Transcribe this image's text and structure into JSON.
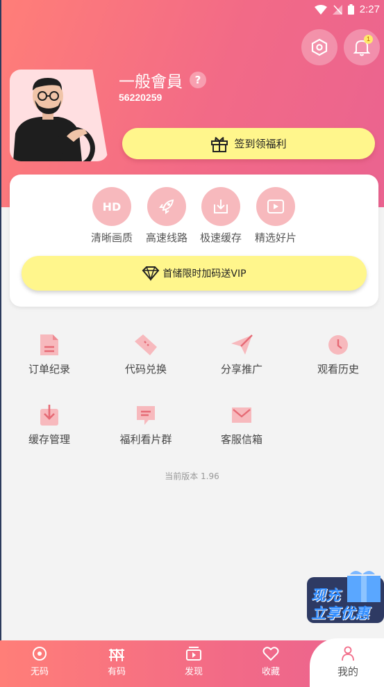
{
  "status_bar": {
    "time": "2:27"
  },
  "header": {
    "member_level": "一般會員",
    "help_label": "?",
    "user_id": "56220259",
    "notification_count": "1",
    "signin_label": "签到领福利"
  },
  "vip_card": {
    "features": [
      {
        "icon": "hd-icon",
        "icon_text": "HD",
        "label": "清晰画质"
      },
      {
        "icon": "rocket-icon",
        "label": "高速线路"
      },
      {
        "icon": "download-icon",
        "label": "极速缓存"
      },
      {
        "icon": "play-icon",
        "label": "精选好片"
      }
    ],
    "promo_label": "首储限时加码送VIP"
  },
  "tools": [
    {
      "icon": "document-icon",
      "label": "订单纪录"
    },
    {
      "icon": "ticket-icon",
      "label": "代码兑换"
    },
    {
      "icon": "paper-plane-icon",
      "label": "分享推广"
    },
    {
      "icon": "clock-icon",
      "label": "观看历史"
    },
    {
      "icon": "download-arrow-icon",
      "label": "缓存管理"
    },
    {
      "icon": "chat-icon",
      "label": "福利看片群"
    },
    {
      "icon": "mail-icon",
      "label": "客服信箱"
    }
  ],
  "version_text": "当前版本 1.96",
  "promo_badge": {
    "line1": "现充",
    "line2": "立享优惠"
  },
  "tabbar": [
    {
      "icon": "disc-icon",
      "label": "无码"
    },
    {
      "icon": "fence-icon",
      "label": "有码"
    },
    {
      "icon": "video-icon",
      "label": "发现"
    },
    {
      "icon": "heart-icon",
      "label": "收藏"
    },
    {
      "icon": "user-icon",
      "label": "我的",
      "active": true
    }
  ],
  "colors": {
    "accent": "#f26a87",
    "button_yellow": "#fff68c",
    "icon_pink": "#f7b9bd"
  }
}
